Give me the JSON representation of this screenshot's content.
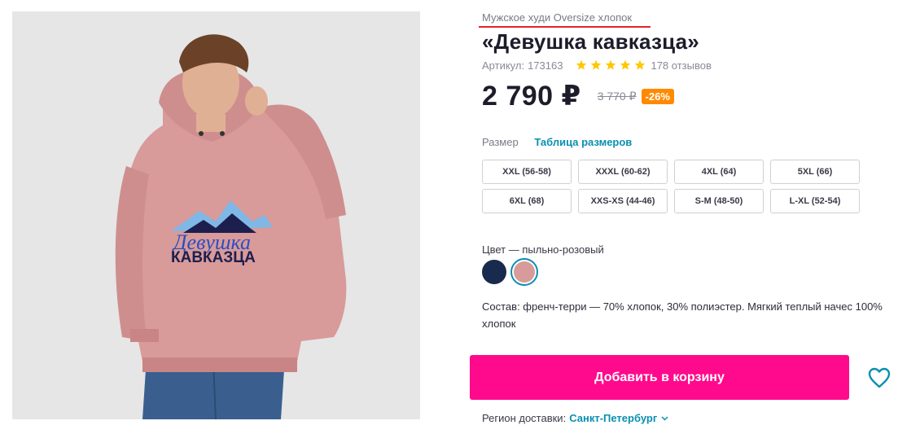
{
  "product": {
    "subtitle": "Мужское худи Oversize хлопок",
    "title": "«Девушка кавказца»",
    "sku_label": "Артикул:",
    "sku_value": "173163",
    "rating": 5,
    "reviews": "178 отзывов",
    "price": "2 790 ₽",
    "old_price": "3 770 ₽",
    "discount": "-26%",
    "print_text_line1": "Девушка",
    "print_text_line2": "КАВКАЗЦА"
  },
  "size": {
    "label": "Размер",
    "table_link": "Таблица размеров",
    "options": [
      "XXL (56-58)",
      "XXXL (60-62)",
      "4XL (64)",
      "5XL (66)",
      "6XL (68)",
      "XXS-XS (44-46)",
      "S-M (48-50)",
      "L-XL (52-54)"
    ]
  },
  "color": {
    "label": "Цвет — пыльно-розовый",
    "swatches": [
      "#182a4e",
      "#d99a9a"
    ],
    "selected_index": 1
  },
  "composition": "Состав: френч-терри — 70% хлопок, 30% полиэстер. Мягкий теплый начес 100% хлопок",
  "actions": {
    "add_to_cart": "Добавить в корзину",
    "favorite_icon": "heart-icon"
  },
  "delivery": {
    "label": "Регион доставки:",
    "city": "Санкт-Петербург"
  },
  "colors": {
    "accent": "#ff0a8c",
    "link": "#0a8fb0",
    "badge": "#ff8a00",
    "star": "#ffc700"
  }
}
